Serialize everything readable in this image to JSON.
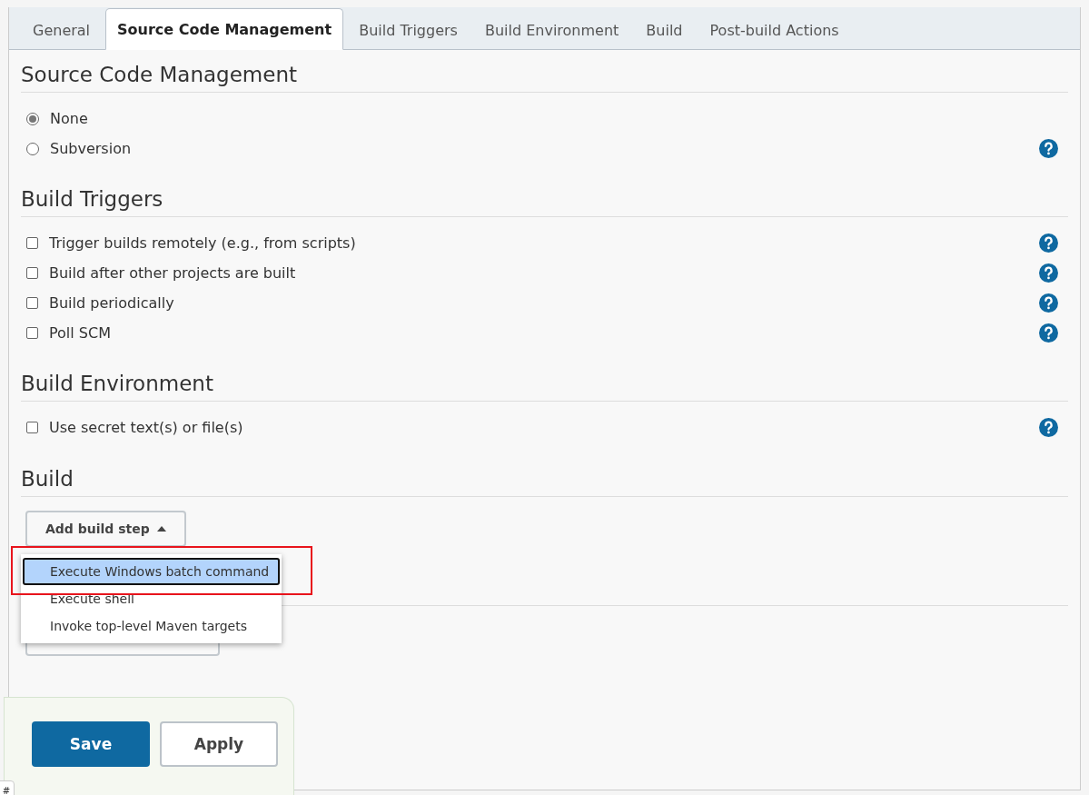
{
  "tabs": [
    {
      "label": "General",
      "selected": false
    },
    {
      "label": "Source Code Management",
      "selected": true
    },
    {
      "label": "Build Triggers",
      "selected": false
    },
    {
      "label": "Build Environment",
      "selected": false
    },
    {
      "label": "Build",
      "selected": false
    },
    {
      "label": "Post-build Actions",
      "selected": false
    }
  ],
  "scm": {
    "title": "Source Code Management",
    "options": [
      {
        "label": "None",
        "selected": true,
        "help": false
      },
      {
        "label": "Subversion",
        "selected": false,
        "help": true
      }
    ]
  },
  "build_triggers": {
    "title": "Build Triggers",
    "items": [
      {
        "label": "Trigger builds remotely (e.g., from scripts)",
        "checked": false
      },
      {
        "label": "Build after other projects are built",
        "checked": false
      },
      {
        "label": "Build periodically",
        "checked": false
      },
      {
        "label": "Poll SCM",
        "checked": false
      }
    ]
  },
  "build_environment": {
    "title": "Build Environment",
    "items": [
      {
        "label": "Use secret text(s) or file(s)",
        "checked": false
      }
    ]
  },
  "build": {
    "title": "Build",
    "add_button": "Add build step",
    "menu": [
      {
        "label": "Execute Windows batch command",
        "selected": true
      },
      {
        "label": "Execute shell",
        "selected": false
      },
      {
        "label": "Invoke top-level Maven targets",
        "selected": false
      }
    ]
  },
  "buttons": {
    "save": "Save",
    "apply": "Apply"
  },
  "corner_tab": "#"
}
